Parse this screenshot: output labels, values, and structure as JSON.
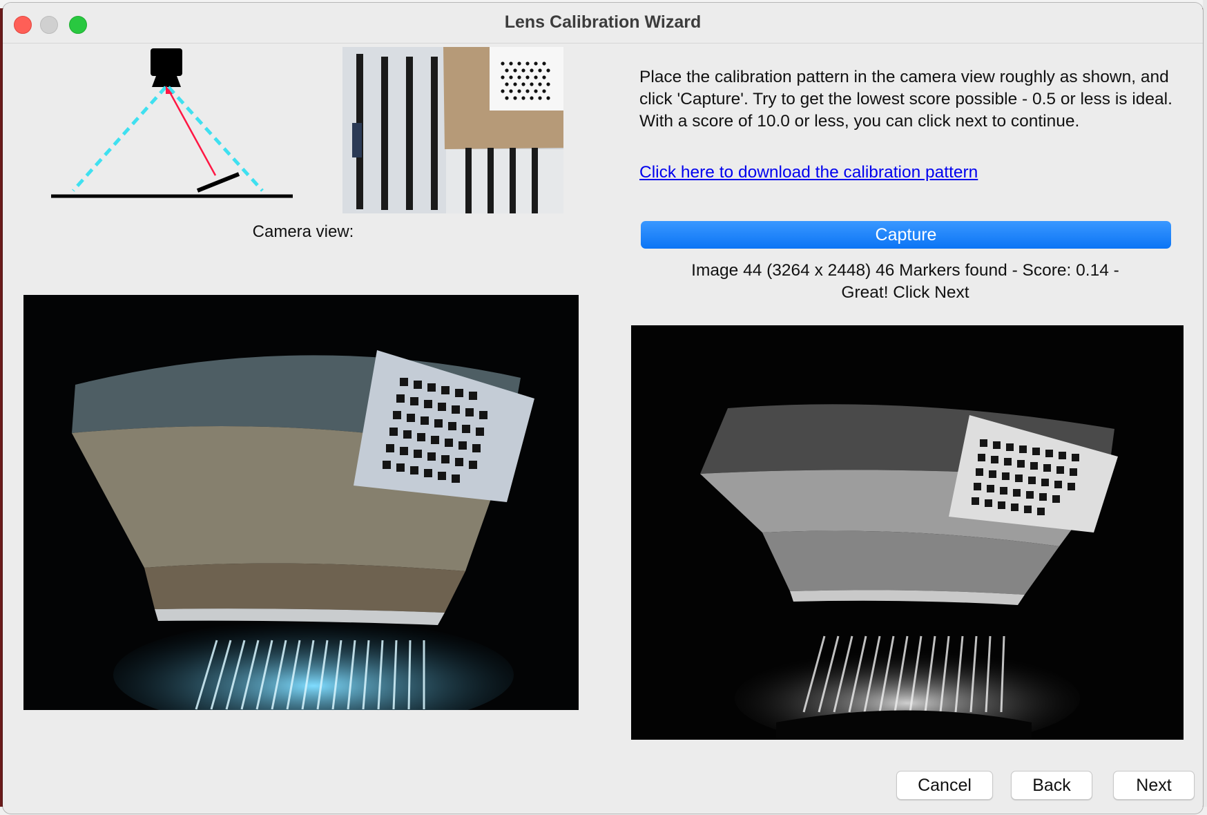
{
  "window": {
    "title": "Lens Calibration Wizard"
  },
  "left": {
    "camera_view_label": "Camera view:"
  },
  "right": {
    "instructions": "Place the calibration pattern in the camera view roughly as shown, and click 'Capture'. Try to get the lowest score possible - 0.5 or less is ideal.  With a score of 10.0 or less, you can click next to continue.",
    "download_link": "Click here to download the calibration pattern",
    "capture_label": "Capture",
    "status_line1": "Image 44 (3264 x 2448) 46 Markers found - Score: 0.14 -",
    "status_line2": "Great! Click Next"
  },
  "footer": {
    "cancel_label": "Cancel",
    "back_label": "Back",
    "next_label": "Next"
  },
  "colors": {
    "accent": "#1a84ff",
    "link": "#0000ee",
    "close": "#fe5f57",
    "maximize": "#29c840"
  }
}
